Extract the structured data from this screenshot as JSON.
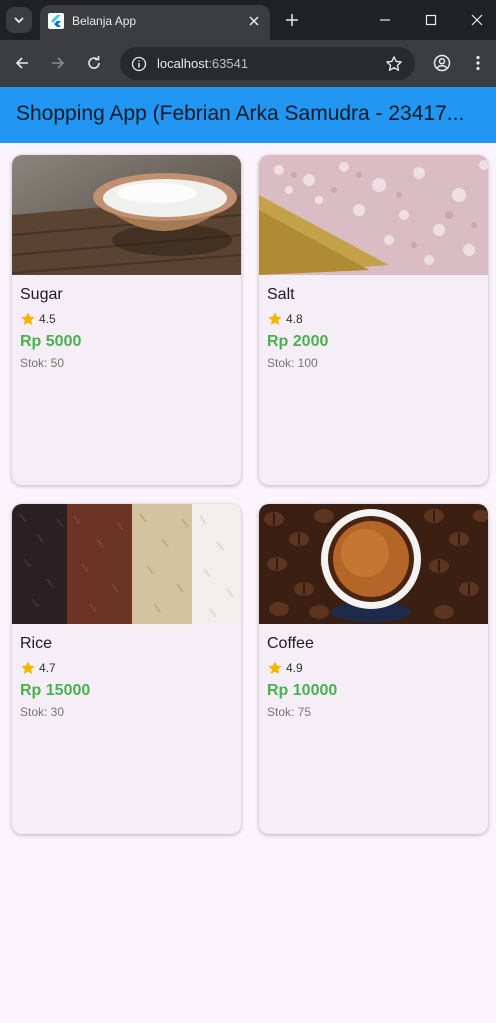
{
  "browser": {
    "tab_title": "Belanja App",
    "url_host": "localhost",
    "url_port": ":63541"
  },
  "app": {
    "title": "Shopping App (Febrian Arka Samudra - 23417..."
  },
  "products": [
    {
      "name": "Sugar",
      "rating": "4.5",
      "price": "Rp 5000",
      "stock": "Stok: 50"
    },
    {
      "name": "Salt",
      "rating": "4.8",
      "price": "Rp 2000",
      "stock": "Stok: 100"
    },
    {
      "name": "Rice",
      "rating": "4.7",
      "price": "Rp 15000",
      "stock": "Stok: 30"
    },
    {
      "name": "Coffee",
      "rating": "4.9",
      "price": "Rp 10000",
      "stock": "Stok: 75"
    }
  ],
  "colors": {
    "appbar": "#2196f3",
    "price": "#4caf50",
    "star": "#f5b400",
    "card_bg": "#f5eef6"
  },
  "icons": [
    "tab-search-icon",
    "flutter-logo-icon",
    "close-icon",
    "plus-icon",
    "minimize-icon",
    "maximize-icon",
    "back-icon",
    "forward-icon",
    "reload-icon",
    "info-icon",
    "bookmark-star-icon",
    "profile-icon",
    "more-icon",
    "star-icon"
  ]
}
